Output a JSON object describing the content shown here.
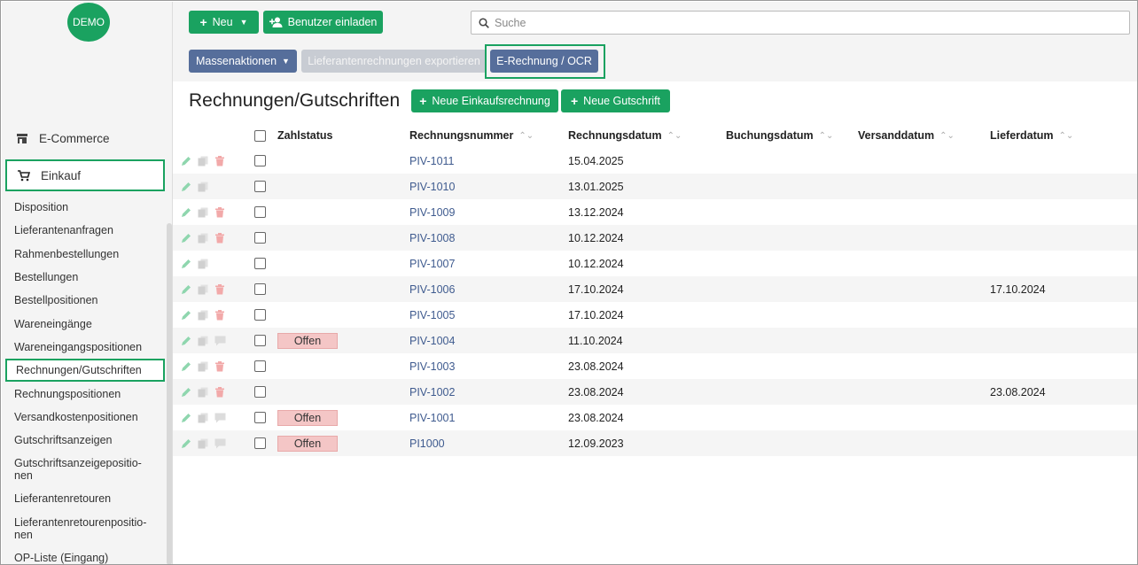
{
  "logo": {
    "label": "DEMO"
  },
  "sidebar": {
    "main_items": [
      {
        "label": "E-Commerce",
        "icon": "store-icon"
      },
      {
        "label": "Einkauf",
        "icon": "cart-icon"
      }
    ],
    "sub_items": [
      "Disposition",
      "Lieferantenanfragen",
      "Rahmenbestellungen",
      "Bestellungen",
      "Bestellpositionen",
      "Wareneingänge",
      "Wareneingangspositionen",
      "Rechnungen/Gutschriften",
      "Rechnungspositionen",
      "Versandkostenpositionen",
      "Gutschriftsanzeigen",
      "Gutschriftsanzeigepositio-\nnen",
      "Lieferantenretouren",
      "Lieferantenretourenpositio-\nnen",
      "OP-Liste (Eingang)"
    ],
    "active_sub_index": 7
  },
  "toolbar": {
    "new_label": "Neu",
    "invite_label": "Benutzer einladen",
    "search_placeholder": "Suche",
    "mass_actions_label": "Massenaktionen",
    "export_label": "Lieferantenrechnungen exportieren",
    "ocr_label": "E-Rechnung / OCR"
  },
  "page": {
    "title": "Rechnungen/Gutschriften",
    "new_invoice_label": "Neue Einkaufsrechnung",
    "new_credit_label": "Neue Gutschrift"
  },
  "table": {
    "headers": {
      "status": "Zahlstatus",
      "number": "Rechnungsnummer",
      "invoice_date": "Rechnungsdatum",
      "booking_date": "Buchungsdatum",
      "shipping_date": "Versanddatum",
      "delivery_date": "Lieferdatum"
    },
    "rows": [
      {
        "number": "PIV-1011",
        "invoice_date": "15.04.2025",
        "status": "",
        "delivery_date": "",
        "third_icon": "trash"
      },
      {
        "number": "PIV-1010",
        "invoice_date": "13.01.2025",
        "status": "",
        "delivery_date": "",
        "third_icon": ""
      },
      {
        "number": "PIV-1009",
        "invoice_date": "13.12.2024",
        "status": "",
        "delivery_date": "",
        "third_icon": "trash"
      },
      {
        "number": "PIV-1008",
        "invoice_date": "10.12.2024",
        "status": "",
        "delivery_date": "",
        "third_icon": "trash"
      },
      {
        "number": "PIV-1007",
        "invoice_date": "10.12.2024",
        "status": "",
        "delivery_date": "",
        "third_icon": ""
      },
      {
        "number": "PIV-1006",
        "invoice_date": "17.10.2024",
        "status": "",
        "delivery_date": "17.10.2024",
        "third_icon": "trash"
      },
      {
        "number": "PIV-1005",
        "invoice_date": "17.10.2024",
        "status": "",
        "delivery_date": "",
        "third_icon": "trash"
      },
      {
        "number": "PIV-1004",
        "invoice_date": "11.10.2024",
        "status": "Offen",
        "delivery_date": "",
        "third_icon": "comment"
      },
      {
        "number": "PIV-1003",
        "invoice_date": "23.08.2024",
        "status": "",
        "delivery_date": "",
        "third_icon": "trash"
      },
      {
        "number": "PIV-1002",
        "invoice_date": "23.08.2024",
        "status": "",
        "delivery_date": "23.08.2024",
        "third_icon": "trash"
      },
      {
        "number": "PIV-1001",
        "invoice_date": "23.08.2024",
        "status": "Offen",
        "delivery_date": "",
        "third_icon": "comment"
      },
      {
        "number": "PI1000",
        "invoice_date": "12.09.2023",
        "status": "Offen",
        "delivery_date": "",
        "third_icon": "comment"
      }
    ]
  },
  "colors": {
    "green": "#1aa260",
    "blue": "#566e9b",
    "link": "#3f5b8f",
    "badge": "#f4c6c6"
  }
}
